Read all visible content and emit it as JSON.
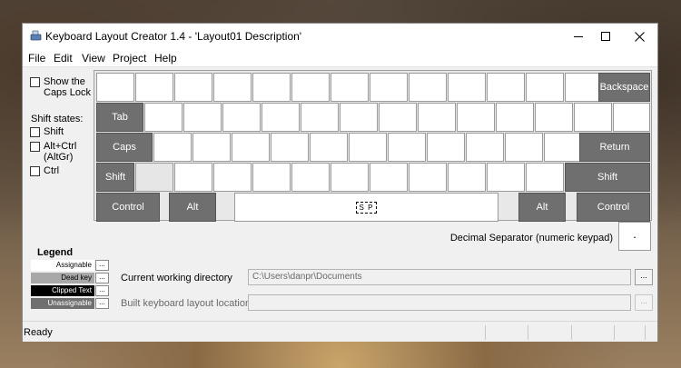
{
  "window": {
    "title": "Keyboard Layout Creator 1.4 - 'Layout01 Description'"
  },
  "menu": [
    "File",
    "Edit",
    "View",
    "Project",
    "Help"
  ],
  "options": {
    "caps_lock_label": "Show the Caps Lock",
    "shift_states_label": "Shift states:",
    "shift_label": "Shift",
    "altgr_label": "Alt+Ctrl (AltGr)",
    "ctrl_label": "Ctrl"
  },
  "keys": {
    "backspace": "Backspace",
    "tab": "Tab",
    "caps": "Caps",
    "return": "Return",
    "shift_left": "Shift",
    "shift_right": "Shift",
    "control_left": "Control",
    "alt_left": "Alt",
    "space": "S P",
    "alt_right": "Alt",
    "control_right": "Control"
  },
  "decimal_separator": {
    "label": "Decimal Separator (numeric keypad)",
    "value": "."
  },
  "legend": {
    "title": "Legend",
    "items": [
      {
        "label": "Assignable",
        "bg": "#ffffff",
        "fg": "#000000",
        "button": "..."
      },
      {
        "label": "Dead key",
        "bg": "#a8a8a8",
        "fg": "#000000",
        "button": "..."
      },
      {
        "label": "Clipped Text",
        "bg": "#000000",
        "fg": "#ffffff",
        "button": "..."
      },
      {
        "label": "Unassignable",
        "bg": "#6f6f6f",
        "fg": "#ffffff",
        "button": "..."
      }
    ]
  },
  "fields": {
    "cwd_label": "Current working directory",
    "cwd_value": "C:\\Users\\danpr\\Documents",
    "cwd_button": "...",
    "build_label": "Built keyboard layout location",
    "build_value": "",
    "build_button": "..."
  },
  "status": {
    "text": "Ready"
  },
  "colors": {
    "unassignable_key": "#6f6f6f",
    "assignable_key": "#ffffff",
    "window_bg": "#f0f0f0"
  }
}
